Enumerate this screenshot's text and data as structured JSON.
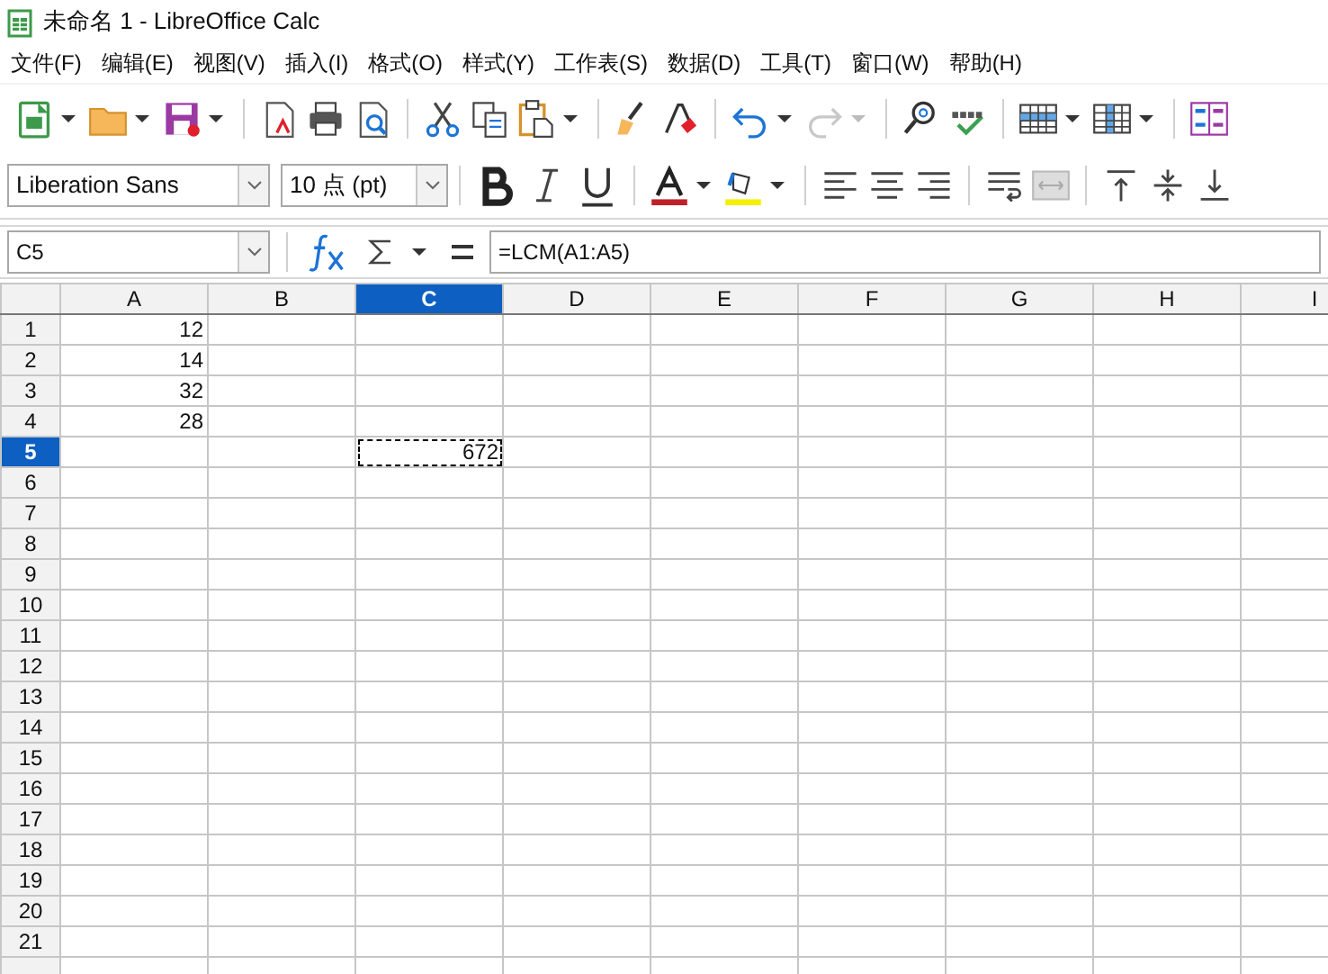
{
  "window": {
    "title": "未命名 1 - LibreOffice Calc"
  },
  "menu": [
    "文件(F)",
    "编辑(E)",
    "视图(V)",
    "插入(I)",
    "格式(O)",
    "样式(Y)",
    "工作表(S)",
    "数据(D)",
    "工具(T)",
    "窗口(W)",
    "帮助(H)"
  ],
  "formatting": {
    "font_name": "Liberation Sans",
    "font_size": "10 点 (pt)"
  },
  "formula_bar": {
    "name_box": "C5",
    "formula": "=LCM(A1:A5)"
  },
  "columns": [
    {
      "label": "A",
      "selected": false
    },
    {
      "label": "B",
      "selected": false
    },
    {
      "label": "C",
      "selected": true
    },
    {
      "label": "D",
      "selected": false
    },
    {
      "label": "E",
      "selected": false
    },
    {
      "label": "F",
      "selected": false
    },
    {
      "label": "G",
      "selected": false
    },
    {
      "label": "H",
      "selected": false
    },
    {
      "label": "I",
      "selected": false
    }
  ],
  "rows": [
    {
      "label": "1",
      "selected": false,
      "cells": [
        {
          "text": "12"
        }
      ]
    },
    {
      "label": "2",
      "selected": false,
      "cells": [
        {
          "text": "14"
        }
      ]
    },
    {
      "label": "3",
      "selected": false,
      "cells": [
        {
          "text": "32"
        }
      ]
    },
    {
      "label": "4",
      "selected": false,
      "cells": [
        {
          "text": "28"
        }
      ]
    },
    {
      "label": "5",
      "selected": true,
      "cells": [
        null,
        null,
        {
          "text": "672",
          "marked": true
        }
      ]
    },
    {
      "label": "6",
      "selected": false
    },
    {
      "label": "7",
      "selected": false
    },
    {
      "label": "8",
      "selected": false
    },
    {
      "label": "9",
      "selected": false
    },
    {
      "label": "10",
      "selected": false
    },
    {
      "label": "11",
      "selected": false
    },
    {
      "label": "12",
      "selected": false
    },
    {
      "label": "13",
      "selected": false
    },
    {
      "label": "14",
      "selected": false
    },
    {
      "label": "15",
      "selected": false
    },
    {
      "label": "16",
      "selected": false
    },
    {
      "label": "17",
      "selected": false
    },
    {
      "label": "18",
      "selected": false
    },
    {
      "label": "19",
      "selected": false
    },
    {
      "label": "20",
      "selected": false
    },
    {
      "label": "21",
      "selected": false
    }
  ]
}
